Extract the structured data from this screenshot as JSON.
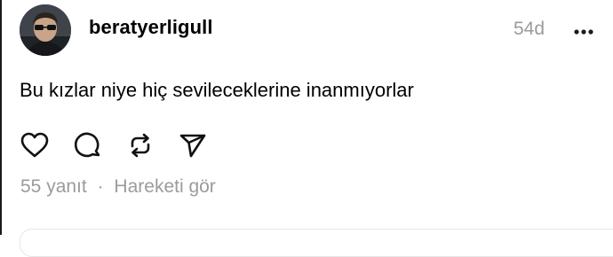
{
  "post": {
    "username": "beratyerligull",
    "time": "54d",
    "text": "Bu kızlar niye hiç sevileceklerine inanmıyorlar"
  },
  "footer": {
    "replies": "55 yanıt",
    "separator": "·",
    "activity": "Hareketi gör"
  },
  "icons": {
    "avatar": "profile-photo",
    "more": "more-horizontal-icon",
    "like": "heart-icon",
    "comment": "comment-icon",
    "repost": "repost-icon",
    "share": "send-icon"
  },
  "colors": {
    "text": "#000000",
    "muted": "#9a9a9a",
    "background": "#ffffff"
  }
}
